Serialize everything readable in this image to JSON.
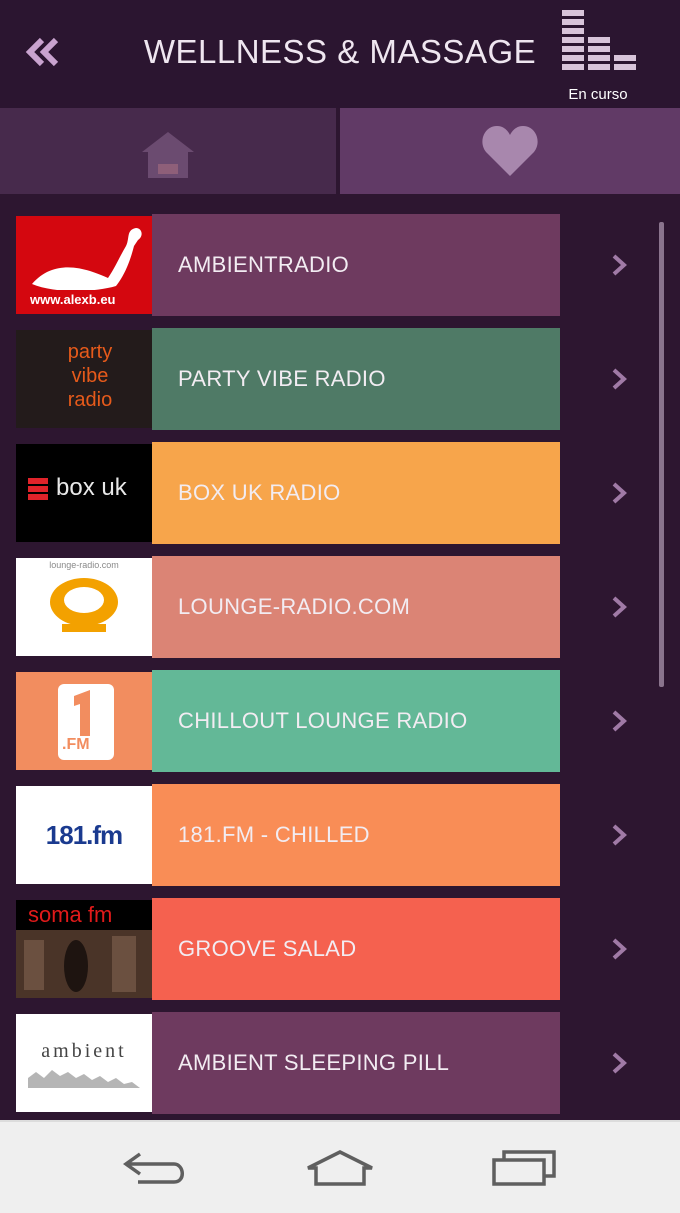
{
  "header": {
    "title": "WELLNESS & MASSAGE",
    "now_playing_label": "En curso"
  },
  "tabs": [
    {
      "name": "home",
      "icon": "home-icon",
      "active": false
    },
    {
      "name": "favorites",
      "icon": "heart-icon",
      "active": true
    }
  ],
  "stations": [
    {
      "label": "AMBIENTRADIO",
      "color": "#6e3a5f",
      "logo_text": "www.alexb.eu"
    },
    {
      "label": "PARTY VIBE RADIO",
      "color": "#4f7a66",
      "logo_text": "party vibe radio"
    },
    {
      "label": "BOX UK RADIO",
      "color": "#f7a54b",
      "logo_text": "box uk"
    },
    {
      "label": "LOUNGE-RADIO.COM",
      "color": "#db8475",
      "logo_text": "lounge-radio.com"
    },
    {
      "label": "CHILLOUT LOUNGE RADIO",
      "color": "#63b897",
      "logo_text": ".FM"
    },
    {
      "label": "181.FM - CHILLED",
      "color": "#f98d56",
      "logo_text": "181.fm"
    },
    {
      "label": "GROOVE SALAD",
      "color": "#f5614f",
      "logo_text": "soma fm"
    },
    {
      "label": "AMBIENT SLEEPING PILL",
      "color": "#6e3a5f",
      "logo_text": "ambient"
    }
  ],
  "colors": {
    "background": "#2d1630",
    "accent": "#c9a3cf"
  },
  "system_nav": [
    "back-icon",
    "home-icon",
    "recents-icon"
  ]
}
